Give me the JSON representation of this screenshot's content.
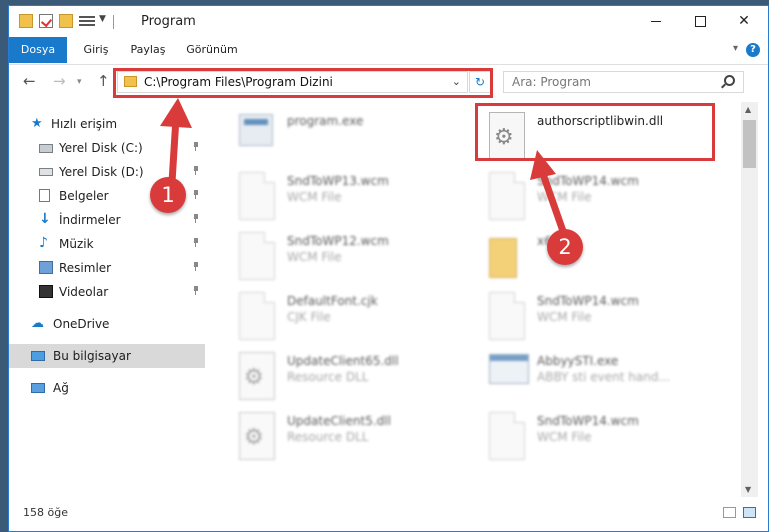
{
  "window": {
    "title": "Program"
  },
  "ribbon": {
    "tabs": [
      "Dosya",
      "Giriş",
      "Paylaş",
      "Görünüm"
    ],
    "help_label": "?"
  },
  "navbar": {
    "address": "C:\\Program Files\\Program Dizini",
    "search_placeholder": "Ara: Program"
  },
  "sidebar": {
    "items": [
      {
        "label": "Hızlı erişim",
        "icon": "star-icon"
      },
      {
        "label": "Yerel Disk (C:)",
        "icon": "drive-icon"
      },
      {
        "label": "Yerel Disk (D:)",
        "icon": "drive-icon"
      },
      {
        "label": "Belgeler",
        "icon": "documents-icon"
      },
      {
        "label": "İndirmeler",
        "icon": "download-icon"
      },
      {
        "label": "Müzik",
        "icon": "music-icon"
      },
      {
        "label": "Resimler",
        "icon": "pictures-icon"
      },
      {
        "label": "Videolar",
        "icon": "video-icon"
      },
      {
        "label": "OneDrive",
        "icon": "cloud-icon"
      },
      {
        "label": "Bu bilgisayar",
        "icon": "computer-icon",
        "selected": true
      },
      {
        "label": "Ağ",
        "icon": "network-icon"
      }
    ]
  },
  "files": [
    {
      "name": "program.exe",
      "type": ""
    },
    {
      "name": "authorscriptlibwin.dll",
      "type": ""
    },
    {
      "name": "SndToWP13.wcm",
      "type": "WCM File"
    },
    {
      "name": "SndToWP14.wcm",
      "type": "WCM File"
    },
    {
      "name": "SndToWP12.wcm",
      "type": "WCM File"
    },
    {
      "name": "x64",
      "type": ""
    },
    {
      "name": "DefaultFont.cjk",
      "type": "CJK File"
    },
    {
      "name": "SndToWP14.wcm",
      "type": "WCM File"
    },
    {
      "name": "UpdateClient65.dll",
      "type": "Resource DLL"
    },
    {
      "name": "AbbyySTI.exe",
      "type": "ABBY sti event hand..."
    },
    {
      "name": "UpdateClient5.dll",
      "type": "Resource DLL"
    },
    {
      "name": "SndToWP14.wcm",
      "type": "WCM File"
    }
  ],
  "status": {
    "count": "158 öğe"
  },
  "annotations": {
    "step1": "1",
    "step2": "2",
    "highlight_color": "#d93a3a"
  }
}
